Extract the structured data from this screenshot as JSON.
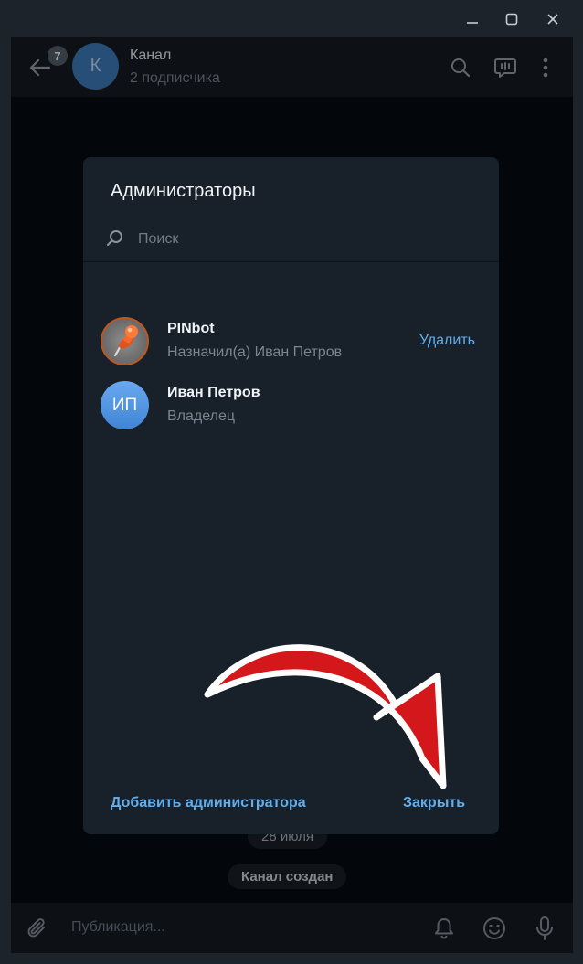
{
  "window": {
    "icons": {
      "minimize": "minimize-icon",
      "maximize": "maximize-icon",
      "close": "close-icon"
    }
  },
  "header": {
    "unread_count": "7",
    "avatar_letter": "К",
    "title": "Канал",
    "subtitle": "2 подписчика",
    "icons": [
      "back-arrow-icon",
      "search-icon",
      "live-stream-icon",
      "more-icon"
    ]
  },
  "dialog": {
    "title": "Администраторы",
    "search_placeholder": "Поиск",
    "admins": [
      {
        "name": "PINbot",
        "subtitle": "Назначил(а) Иван Петров",
        "action": "Удалить",
        "avatar": "pushpin-avatar"
      },
      {
        "name": "Иван Петров",
        "subtitle": "Владелец",
        "initials": "ИП"
      }
    ],
    "add_admin_label": "Добавить администратора",
    "close_label": "Закрыть"
  },
  "chat": {
    "date_chip": "28 июля",
    "service_message": "Канал создан"
  },
  "composer": {
    "placeholder": "Публикация...",
    "icons": [
      "attach-icon",
      "bell-icon",
      "emoji-icon",
      "microphone-icon"
    ]
  },
  "colors": {
    "accent": "#63aeea",
    "dialog_bg": "#18202a",
    "header_bg": "#151c24",
    "annotation_arrow": "#d4171b"
  }
}
